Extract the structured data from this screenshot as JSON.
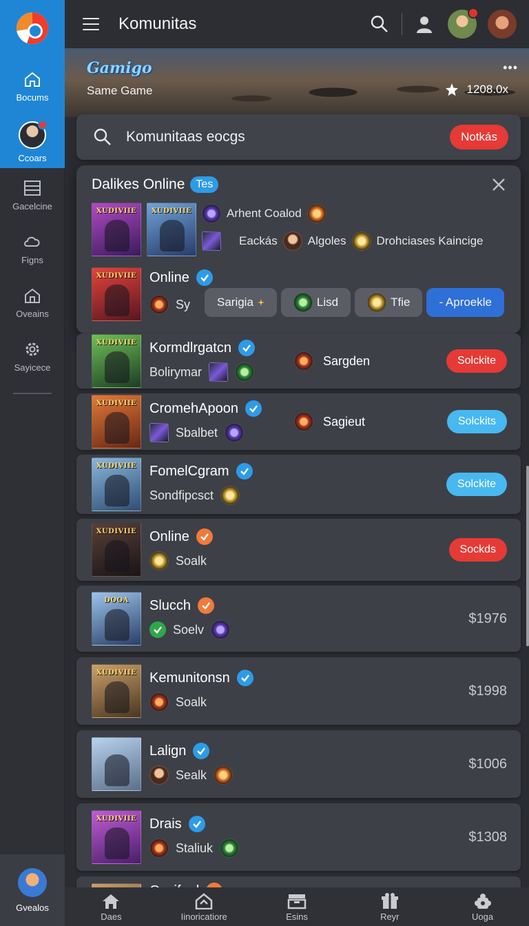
{
  "sidebar": {
    "logo_icon": "app-logo-icon",
    "items": [
      {
        "label": "Bocums",
        "icon": "home-icon",
        "active": true
      },
      {
        "label": "Ccoars",
        "icon": "avatar",
        "active": true
      },
      {
        "label": "Gacelcine",
        "icon": "list-icon"
      },
      {
        "label": "Figns",
        "icon": "cloud-icon"
      },
      {
        "label": "Oveains",
        "icon": "house-icon"
      },
      {
        "label": "Sayicece",
        "icon": "gear-icon"
      }
    ],
    "bottom_label": "Gvealos"
  },
  "topbar": {
    "title": "Komunitas"
  },
  "banner": {
    "logo_text": "Gamigo",
    "subtitle": "Same Game",
    "more": "•••",
    "count": "1208.0x"
  },
  "search": {
    "text": "Komunitaas eocgs",
    "button": "Notkás"
  },
  "popup": {
    "title": "Dalikes Online",
    "tag": "Tes",
    "thumb_titles": [
      "XUDIVIIE",
      "XUDIVIIE",
      "XUDIVIIE"
    ],
    "meta1_text": "Arhent Coalod",
    "meta2": [
      "Eackás",
      "Algoles",
      "Drohciases Kaincige"
    ],
    "featured": {
      "name": "Online",
      "sub": "Sy"
    },
    "chips": [
      "Sarigia",
      "Lisd",
      "Tfie",
      "- Aproekle"
    ]
  },
  "cards": [
    {
      "thumb_title": "XUDIVIIE",
      "name": "Kormdlrgatcn",
      "sub": "Bolirymar",
      "mid": "Sargden",
      "action": "Solckite"
    },
    {
      "thumb_title": "XUDIVIIE",
      "name": "CromehApoon",
      "sub": "Sbalbet",
      "mid": "Sagieut",
      "action": "Solckits"
    },
    {
      "thumb_title": "XUDIVIIE",
      "name": "FomelCgram",
      "sub": "Sondfipcsct",
      "action": "Solckite"
    },
    {
      "thumb_title": "XUDIVIIE",
      "name": "Online",
      "sub": "Soalk",
      "action": "Sockds"
    },
    {
      "thumb_title": "DOOA",
      "name": "Slucch",
      "sub": "Soelv",
      "price": "$1976"
    },
    {
      "thumb_title": "XUDIVIIE",
      "name": "Kemunitonsn",
      "sub": "Soalk",
      "price": "$1998"
    },
    {
      "thumb_title": "",
      "name": "Lalign",
      "sub": "Sealk",
      "price": "$1006"
    },
    {
      "thumb_title": "XUDIVIIE",
      "name": "Drais",
      "sub": "Staliuk",
      "price": "$1308"
    },
    {
      "thumb_title": "",
      "name": "Ocsifual"
    }
  ],
  "bottomnav": [
    {
      "label": "Daes",
      "icon": "home-icon"
    },
    {
      "label": "Iinoricatiore",
      "icon": "house-icon"
    },
    {
      "label": "Esins",
      "icon": "inbox-icon"
    },
    {
      "label": "Reyr",
      "icon": "gift-icon"
    },
    {
      "label": "Uoga",
      "icon": "puzzle-icon"
    }
  ],
  "colors": {
    "accent": "#1f86d6",
    "danger": "#e53a36",
    "cyan": "#48b8f0",
    "verified": "#2e9be8",
    "card": "#3d4047"
  }
}
